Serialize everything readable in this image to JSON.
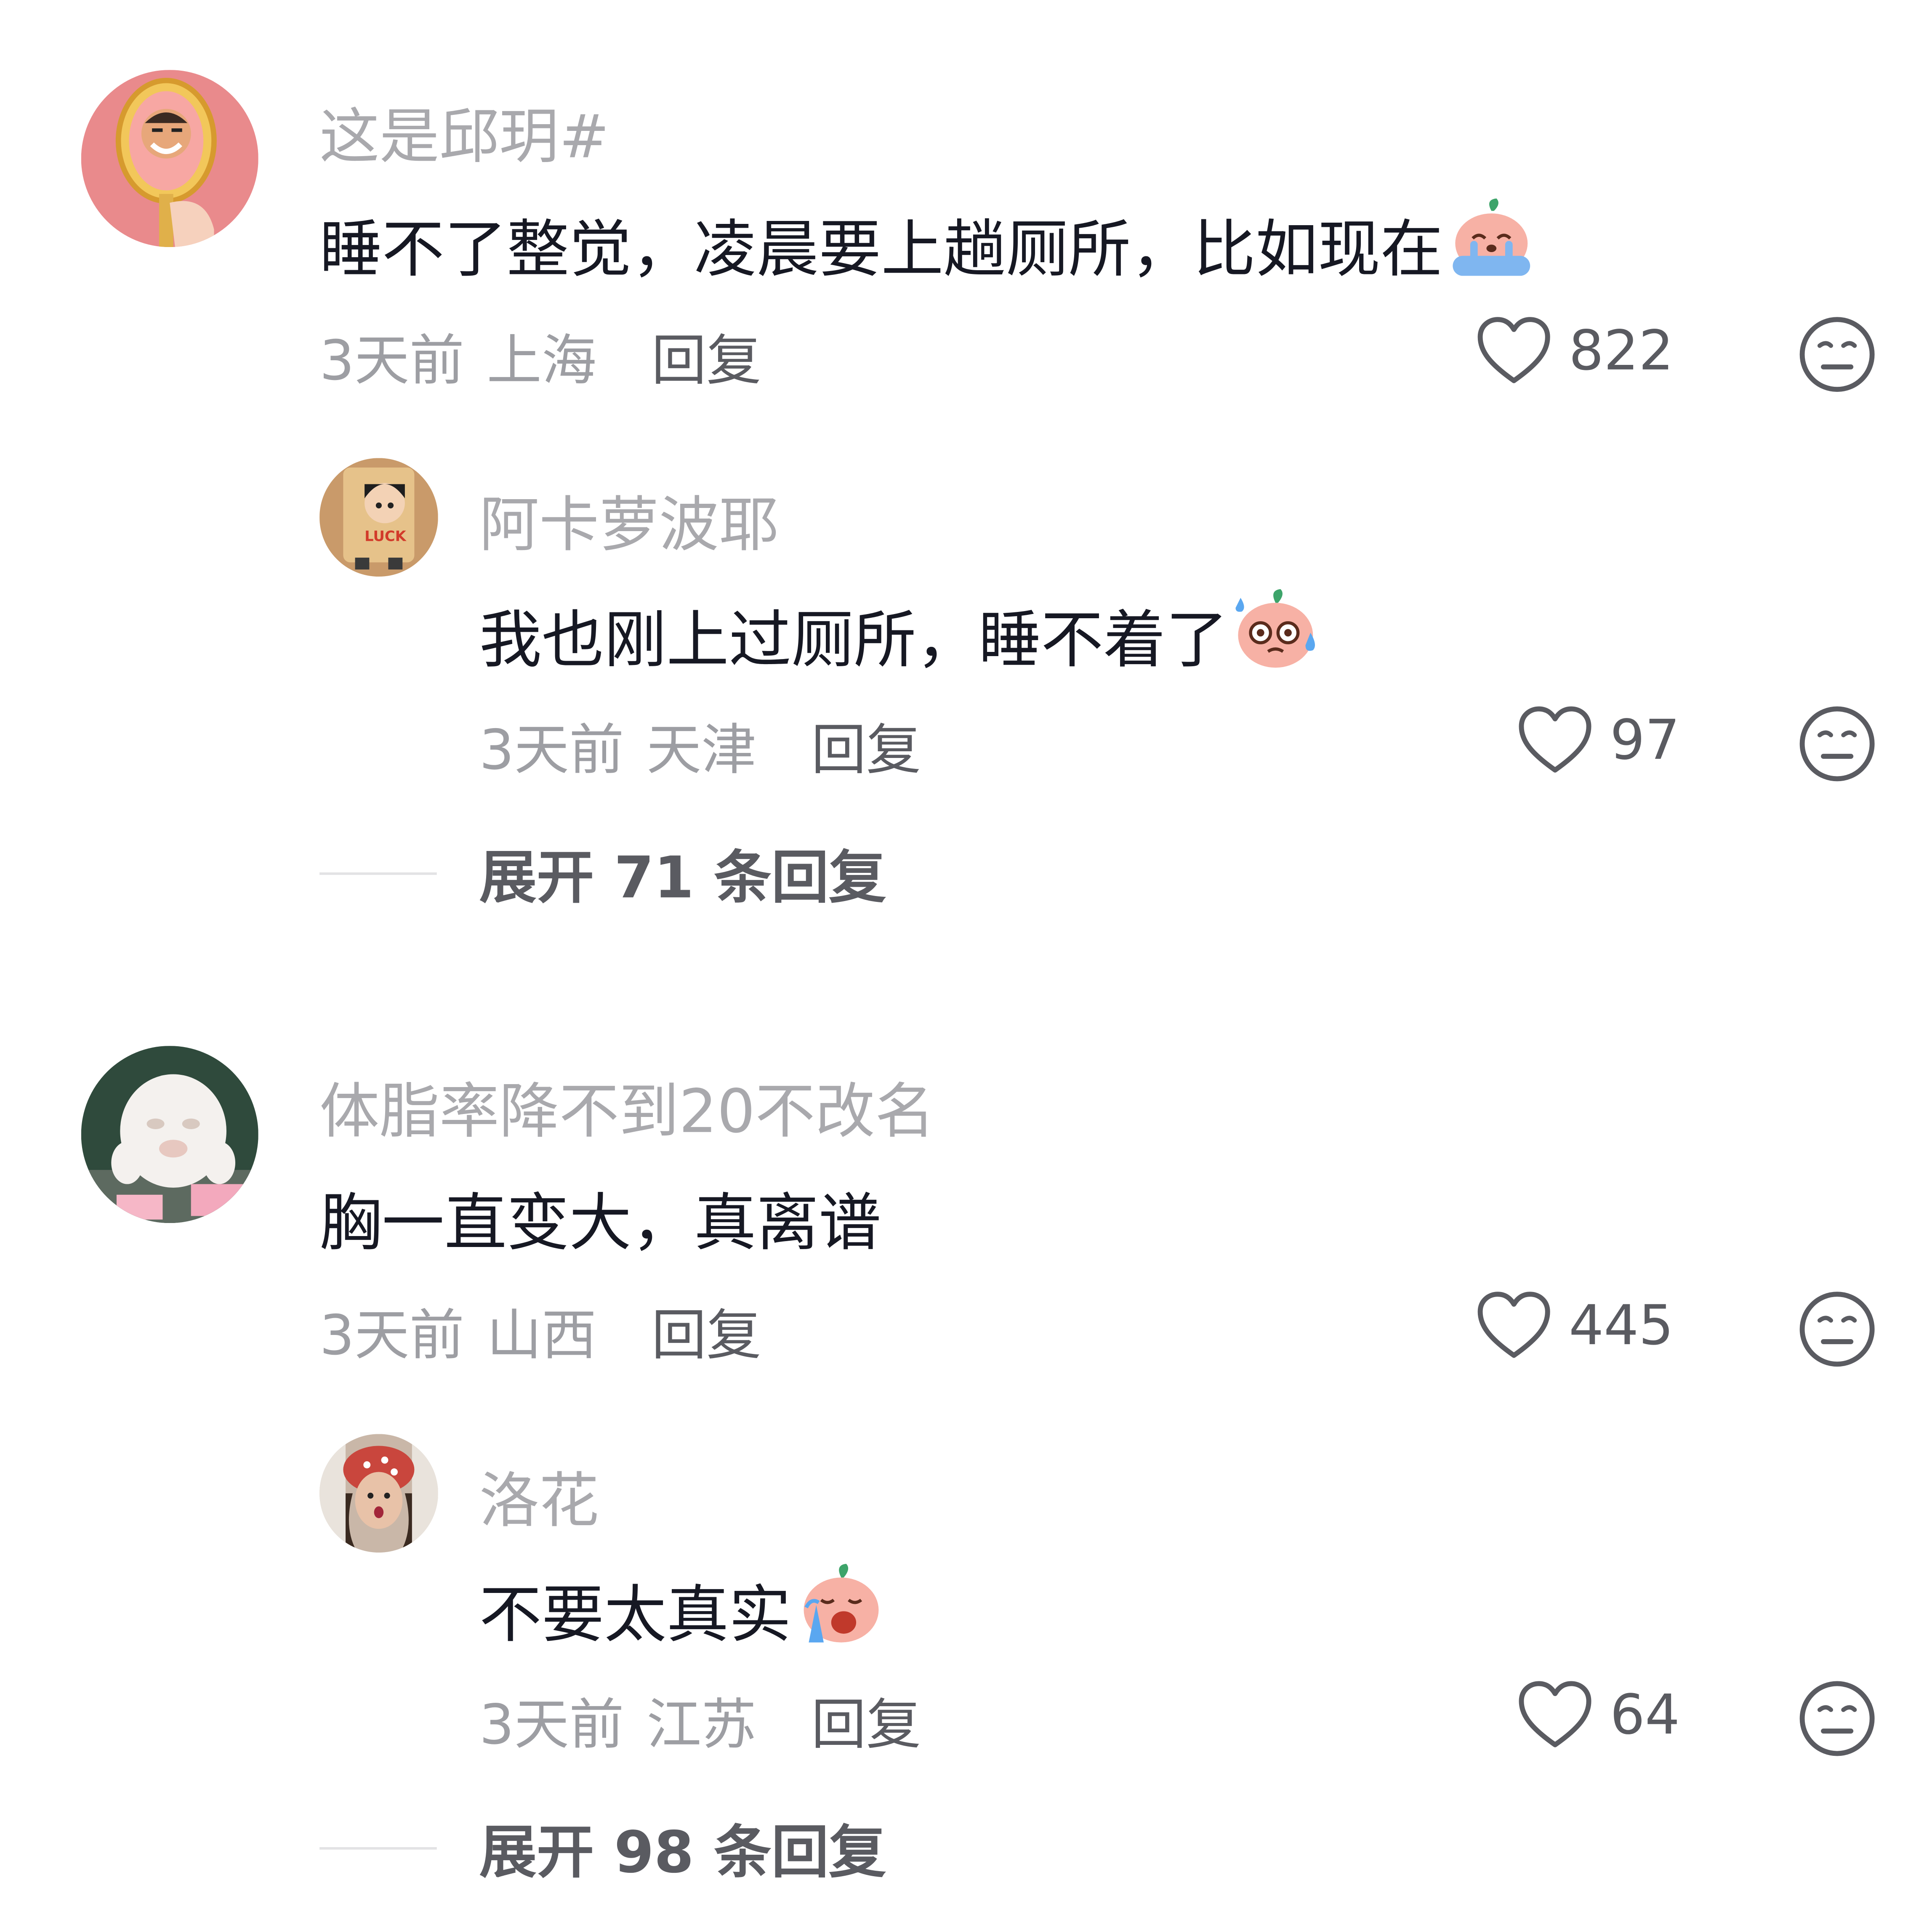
{
  "comments": [
    {
      "username": "这是邱玥#",
      "text": "睡不了整觉，凌晨要上趟厕所，比如现在",
      "emoji_icon": "crying-face-emoji",
      "time": "3天前",
      "location": "上海",
      "reply_label": "回复",
      "likes": "822",
      "replies": [
        {
          "username": "阿卡萝波耶",
          "text": "我也刚上过厕所，睡不着了",
          "emoji_icon": "nervous-sweat-emoji",
          "time": "3天前",
          "location": "天津",
          "reply_label": "回复",
          "likes": "97"
        }
      ],
      "expand_label": "展开 71 条回复"
    },
    {
      "username": "体脂率降不到20不改名",
      "text": "胸一直变大，真离谱",
      "time": "3天前",
      "location": "山西",
      "reply_label": "回复",
      "likes": "445",
      "replies": [
        {
          "username": "洛花",
          "text": "不要太真实",
          "emoji_icon": "loud-crying-emoji",
          "time": "3天前",
          "location": "江苏",
          "reply_label": "回复",
          "likes": "64"
        }
      ],
      "expand_label": "展开 98 条回复"
    }
  ],
  "icons": {
    "like": "heart-outline-icon",
    "dislike": "neutral-face-icon"
  },
  "colors": {
    "username": "#a9a9ad",
    "text": "#161823",
    "meta": "#9d9ea3",
    "action": "#5a5b61"
  }
}
